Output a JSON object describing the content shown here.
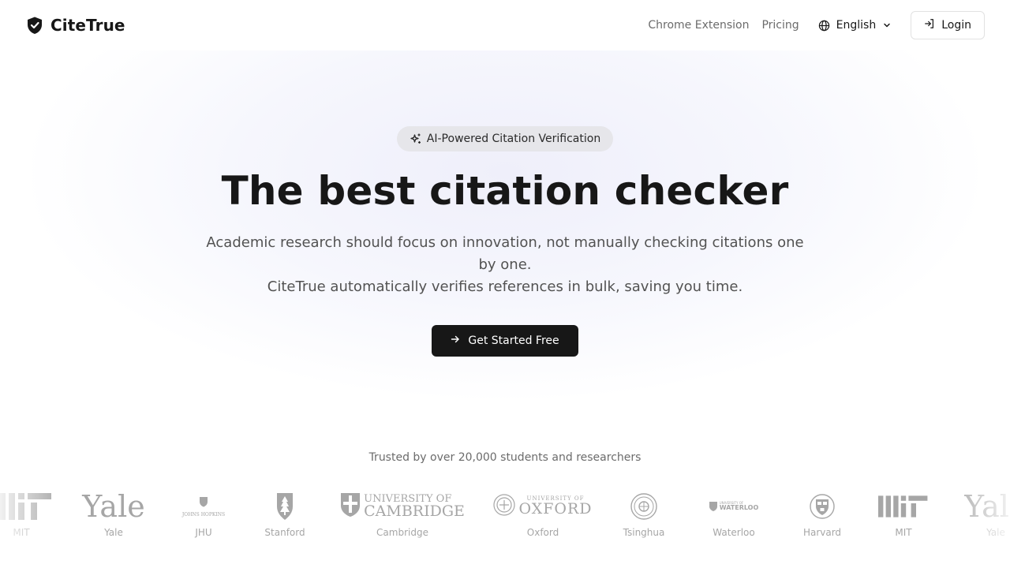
{
  "header": {
    "brand": "CiteTrue",
    "brand_icon": "shield-check-icon",
    "nav": [
      "Chrome Extension",
      "Pricing"
    ],
    "language": "English",
    "login_label": "Login"
  },
  "hero": {
    "badge": "AI-Powered Citation Verification",
    "title": "The best citation checker",
    "subtitle_line1": "Academic research should focus on innovation, not manually checking citations one by one.",
    "subtitle_line2": "CiteTrue automatically verifies references in bulk, saving you time.",
    "cta_label": "Get Started Free"
  },
  "trusted": {
    "text": "Trusted by over 20,000 students and researchers",
    "logos": [
      {
        "name": "MIT",
        "wordmark": ""
      },
      {
        "name": "Yale",
        "wordmark": "Yale"
      },
      {
        "name": "JHU",
        "wordmark": "JOHNS HOPKINS"
      },
      {
        "name": "Stanford",
        "wordmark": ""
      },
      {
        "name": "Cambridge",
        "wordmark_top": "UNIVERSITY OF",
        "wordmark_bottom": "CAMBRIDGE"
      },
      {
        "name": "Oxford",
        "wordmark_top": "UNIVERSITY OF",
        "wordmark_bottom": "OXFORD"
      },
      {
        "name": "Tsinghua",
        "wordmark": ""
      },
      {
        "name": "Waterloo",
        "wordmark_top": "UNIVERSITY OF",
        "wordmark_bottom": "WATERLOO"
      },
      {
        "name": "Harvard",
        "wordmark": ""
      },
      {
        "name": "MIT",
        "wordmark": ""
      },
      {
        "name": "Yale",
        "wordmark": "Yale"
      }
    ]
  },
  "colors": {
    "primary": "#171717",
    "muted_text": "#6b6b6b",
    "logo_gray": "#a6a6a6",
    "badge_bg": "#e6e6ea"
  }
}
